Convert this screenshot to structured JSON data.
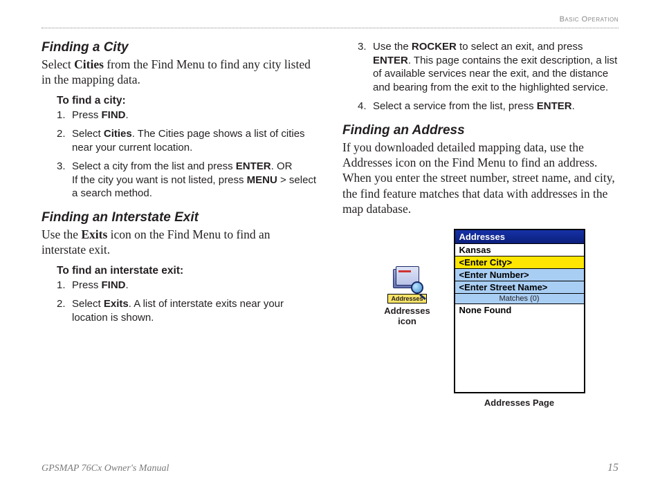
{
  "header": {
    "section": "Basic Operation"
  },
  "left": {
    "h_city": "Finding a City",
    "p_city_pre": "Select ",
    "p_city_bold": "Cities",
    "p_city_post": " from the Find Menu to find any city listed in the mapping data.",
    "instr_city_title": "To find a city:",
    "steps_city": {
      "s1_pre": "Press ",
      "s1_b": "FIND",
      "s1_post": ".",
      "s2_pre": "Select ",
      "s2_b": "Cities",
      "s2_post": ". The Cities page shows a list of cities near your current location.",
      "s3_pre": "Select a city from the list and press ",
      "s3_b1": "ENTER",
      "s3_mid": ". OR",
      "s3_line2_pre": "If the city you want is not listed, press ",
      "s3_b2": "MENU",
      "s3_line2_post": " > select a search method."
    },
    "h_exit": "Finding an Interstate Exit",
    "p_exit_pre": "Use the ",
    "p_exit_bold": "Exits",
    "p_exit_post": " icon on the Find Menu to find an interstate exit.",
    "instr_exit_title": "To find an interstate exit:",
    "steps_exit": {
      "s1_pre": "Press ",
      "s1_b": "FIND",
      "s1_post": ".",
      "s2_pre": "Select ",
      "s2_b": "Exits",
      "s2_post": ". A list of interstate exits near your location is shown."
    }
  },
  "right": {
    "steps_cont": {
      "s3_pre": "Use the ",
      "s3_b1": "ROCKER",
      "s3_mid": " to select an exit, and press ",
      "s3_b2": "ENTER",
      "s3_post": ". This page contains the exit description, a list of available services near the exit, and the distance and bearing from the exit to the highlighted service.",
      "s4_pre": "Select a service from the list, press ",
      "s4_b": "ENTER",
      "s4_post": "."
    },
    "h_addr": "Finding an Address",
    "p_addr": "If you downloaded detailed mapping data, use the Addresses icon on the Find Menu to find an address. When you enter the street number, street name, and city, the find feature matches that data with addresses in the map database.",
    "icon_label": "Addresses",
    "icon_caption_l1": "Addresses",
    "icon_caption_l2": "icon",
    "screen": {
      "title": "Addresses",
      "row_state": "Kansas",
      "row_city": "<Enter City>",
      "row_number": "<Enter Number>",
      "row_street": "<Enter Street Name>",
      "matches": "Matches (0)",
      "none": "None Found"
    },
    "screen_caption": "Addresses Page"
  },
  "footer": {
    "left": "GPSMAP 76Cx Owner's Manual",
    "right": "15"
  }
}
